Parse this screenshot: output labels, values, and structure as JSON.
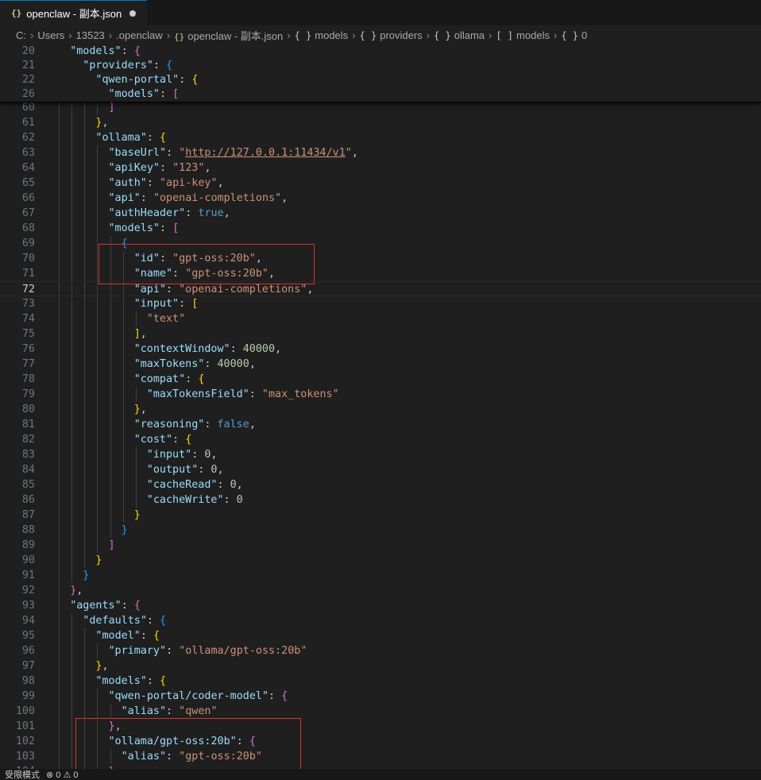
{
  "tab": {
    "icon": "json-file-icon",
    "title": "openclaw - 副本.json"
  },
  "breadcrumb": [
    {
      "label": "C:",
      "icon": "none"
    },
    {
      "label": "Users",
      "icon": "none"
    },
    {
      "label": "13523",
      "icon": "none"
    },
    {
      "label": ".openclaw",
      "icon": "none"
    },
    {
      "label": "openclaw - 副本.json",
      "icon": "json-file-icon"
    },
    {
      "label": "models",
      "icon": "object-icon"
    },
    {
      "label": "providers",
      "icon": "object-icon"
    },
    {
      "label": "ollama",
      "icon": "object-icon"
    },
    {
      "label": "models",
      "icon": "array-icon"
    },
    {
      "label": "0",
      "icon": "object-icon"
    }
  ],
  "sticky_lines": [
    {
      "num": "20",
      "indent": 2,
      "tokens": [
        [
          "k",
          "\"models\""
        ],
        [
          "p",
          ": "
        ],
        [
          "b2",
          "{"
        ]
      ]
    },
    {
      "num": "21",
      "indent": 3,
      "tokens": [
        [
          "k",
          "\"providers\""
        ],
        [
          "p",
          ": "
        ],
        [
          "b3",
          "{"
        ]
      ]
    },
    {
      "num": "22",
      "indent": 4,
      "tokens": [
        [
          "k",
          "\"qwen-portal\""
        ],
        [
          "p",
          ": "
        ],
        [
          "b1",
          "{"
        ]
      ]
    },
    {
      "num": "26",
      "indent": 5,
      "tokens": [
        [
          "k",
          "\"models\""
        ],
        [
          "p",
          ": "
        ],
        [
          "b2",
          "["
        ]
      ]
    }
  ],
  "lines": [
    {
      "num": "60",
      "indent": 5,
      "tokens": [
        [
          "b2",
          "]"
        ]
      ]
    },
    {
      "num": "61",
      "indent": 4,
      "tokens": [
        [
          "b1",
          "}"
        ],
        [
          "p",
          ","
        ]
      ]
    },
    {
      "num": "62",
      "indent": 4,
      "tokens": [
        [
          "k",
          "\"ollama\""
        ],
        [
          "p",
          ": "
        ],
        [
          "b1",
          "{"
        ]
      ]
    },
    {
      "num": "63",
      "indent": 5,
      "tokens": [
        [
          "k",
          "\"baseUrl\""
        ],
        [
          "p",
          ": "
        ],
        [
          "s",
          "\""
        ],
        [
          "u",
          "http://127.0.0.1:11434/v1"
        ],
        [
          "s",
          "\""
        ],
        [
          "p",
          ","
        ]
      ]
    },
    {
      "num": "64",
      "indent": 5,
      "tokens": [
        [
          "k",
          "\"apiKey\""
        ],
        [
          "p",
          ": "
        ],
        [
          "s",
          "\"123\""
        ],
        [
          "p",
          ","
        ]
      ]
    },
    {
      "num": "65",
      "indent": 5,
      "tokens": [
        [
          "k",
          "\"auth\""
        ],
        [
          "p",
          ": "
        ],
        [
          "s",
          "\"api-key\""
        ],
        [
          "p",
          ","
        ]
      ]
    },
    {
      "num": "66",
      "indent": 5,
      "tokens": [
        [
          "k",
          "\"api\""
        ],
        [
          "p",
          ": "
        ],
        [
          "s",
          "\"openai-completions\""
        ],
        [
          "p",
          ","
        ]
      ]
    },
    {
      "num": "67",
      "indent": 5,
      "tokens": [
        [
          "k",
          "\"authHeader\""
        ],
        [
          "p",
          ": "
        ],
        [
          "b",
          "true"
        ],
        [
          "p",
          ","
        ]
      ]
    },
    {
      "num": "68",
      "indent": 5,
      "tokens": [
        [
          "k",
          "\"models\""
        ],
        [
          "p",
          ": "
        ],
        [
          "b2",
          "["
        ]
      ]
    },
    {
      "num": "69",
      "indent": 6,
      "tokens": [
        [
          "b3",
          "{"
        ]
      ]
    },
    {
      "num": "70",
      "indent": 7,
      "tokens": [
        [
          "k",
          "\"id\""
        ],
        [
          "p",
          ": "
        ],
        [
          "s",
          "\"gpt-oss:20b\""
        ],
        [
          "p",
          ","
        ]
      ]
    },
    {
      "num": "71",
      "indent": 7,
      "tokens": [
        [
          "k",
          "\"name\""
        ],
        [
          "p",
          ": "
        ],
        [
          "s",
          "\"gpt-oss:20b\""
        ],
        [
          "p",
          ","
        ]
      ]
    },
    {
      "num": "72",
      "indent": 7,
      "tokens": [
        [
          "k",
          "\"api\""
        ],
        [
          "p",
          ": "
        ],
        [
          "s",
          "\"openai-completions\""
        ],
        [
          "p",
          ","
        ]
      ],
      "current": true
    },
    {
      "num": "73",
      "indent": 7,
      "tokens": [
        [
          "k",
          "\"input\""
        ],
        [
          "p",
          ": "
        ],
        [
          "b1",
          "["
        ]
      ]
    },
    {
      "num": "74",
      "indent": 8,
      "tokens": [
        [
          "s",
          "\"text\""
        ]
      ]
    },
    {
      "num": "75",
      "indent": 7,
      "tokens": [
        [
          "b1",
          "]"
        ],
        [
          "p",
          ","
        ]
      ]
    },
    {
      "num": "76",
      "indent": 7,
      "tokens": [
        [
          "k",
          "\"contextWindow\""
        ],
        [
          "p",
          ": "
        ],
        [
          "n",
          "40000"
        ],
        [
          "p",
          ","
        ]
      ]
    },
    {
      "num": "77",
      "indent": 7,
      "tokens": [
        [
          "k",
          "\"maxTokens\""
        ],
        [
          "p",
          ": "
        ],
        [
          "n",
          "40000"
        ],
        [
          "p",
          ","
        ]
      ]
    },
    {
      "num": "78",
      "indent": 7,
      "tokens": [
        [
          "k",
          "\"compat\""
        ],
        [
          "p",
          ": "
        ],
        [
          "b1",
          "{"
        ]
      ]
    },
    {
      "num": "79",
      "indent": 8,
      "tokens": [
        [
          "k",
          "\"maxTokensField\""
        ],
        [
          "p",
          ": "
        ],
        [
          "s",
          "\"max_tokens\""
        ]
      ]
    },
    {
      "num": "80",
      "indent": 7,
      "tokens": [
        [
          "b1",
          "}"
        ],
        [
          "p",
          ","
        ]
      ]
    },
    {
      "num": "81",
      "indent": 7,
      "tokens": [
        [
          "k",
          "\"reasoning\""
        ],
        [
          "p",
          ": "
        ],
        [
          "b",
          "false"
        ],
        [
          "p",
          ","
        ]
      ]
    },
    {
      "num": "82",
      "indent": 7,
      "tokens": [
        [
          "k",
          "\"cost\""
        ],
        [
          "p",
          ": "
        ],
        [
          "b1",
          "{"
        ]
      ]
    },
    {
      "num": "83",
      "indent": 8,
      "tokens": [
        [
          "k",
          "\"input\""
        ],
        [
          "p",
          ": "
        ],
        [
          "n",
          "0"
        ],
        [
          "p",
          ","
        ]
      ]
    },
    {
      "num": "84",
      "indent": 8,
      "tokens": [
        [
          "k",
          "\"output\""
        ],
        [
          "p",
          ": "
        ],
        [
          "n",
          "0"
        ],
        [
          "p",
          ","
        ]
      ]
    },
    {
      "num": "85",
      "indent": 8,
      "tokens": [
        [
          "k",
          "\"cacheRead\""
        ],
        [
          "p",
          ": "
        ],
        [
          "n",
          "0"
        ],
        [
          "p",
          ","
        ]
      ]
    },
    {
      "num": "86",
      "indent": 8,
      "tokens": [
        [
          "k",
          "\"cacheWrite\""
        ],
        [
          "p",
          ": "
        ],
        [
          "n",
          "0"
        ]
      ]
    },
    {
      "num": "87",
      "indent": 7,
      "tokens": [
        [
          "b1",
          "}"
        ]
      ]
    },
    {
      "num": "88",
      "indent": 6,
      "tokens": [
        [
          "b3",
          "}"
        ]
      ]
    },
    {
      "num": "89",
      "indent": 5,
      "tokens": [
        [
          "b2",
          "]"
        ]
      ]
    },
    {
      "num": "90",
      "indent": 4,
      "tokens": [
        [
          "b1",
          "}"
        ]
      ]
    },
    {
      "num": "91",
      "indent": 3,
      "tokens": [
        [
          "b3",
          "}"
        ]
      ]
    },
    {
      "num": "92",
      "indent": 2,
      "tokens": [
        [
          "b2",
          "}"
        ],
        [
          "p",
          ","
        ]
      ]
    },
    {
      "num": "93",
      "indent": 2,
      "tokens": [
        [
          "k",
          "\"agents\""
        ],
        [
          "p",
          ": "
        ],
        [
          "b2",
          "{"
        ]
      ]
    },
    {
      "num": "94",
      "indent": 3,
      "tokens": [
        [
          "k",
          "\"defaults\""
        ],
        [
          "p",
          ": "
        ],
        [
          "b3",
          "{"
        ]
      ]
    },
    {
      "num": "95",
      "indent": 4,
      "tokens": [
        [
          "k",
          "\"model\""
        ],
        [
          "p",
          ": "
        ],
        [
          "b1",
          "{"
        ]
      ]
    },
    {
      "num": "96",
      "indent": 5,
      "tokens": [
        [
          "k",
          "\"primary\""
        ],
        [
          "p",
          ": "
        ],
        [
          "s",
          "\"ollama/gpt-oss:20b\""
        ]
      ]
    },
    {
      "num": "97",
      "indent": 4,
      "tokens": [
        [
          "b1",
          "}"
        ],
        [
          "p",
          ","
        ]
      ]
    },
    {
      "num": "98",
      "indent": 4,
      "tokens": [
        [
          "k",
          "\"models\""
        ],
        [
          "p",
          ": "
        ],
        [
          "b1",
          "{"
        ]
      ]
    },
    {
      "num": "99",
      "indent": 5,
      "tokens": [
        [
          "k",
          "\"qwen-portal/coder-model\""
        ],
        [
          "p",
          ": "
        ],
        [
          "b2",
          "{"
        ]
      ]
    },
    {
      "num": "100",
      "indent": 6,
      "tokens": [
        [
          "k",
          "\"alias\""
        ],
        [
          "p",
          ": "
        ],
        [
          "s",
          "\"qwen\""
        ]
      ]
    },
    {
      "num": "101",
      "indent": 5,
      "tokens": [
        [
          "b2",
          "}"
        ],
        [
          "p",
          ","
        ]
      ]
    },
    {
      "num": "102",
      "indent": 5,
      "tokens": [
        [
          "k",
          "\"ollama/gpt-oss:20b\""
        ],
        [
          "p",
          ": "
        ],
        [
          "b2",
          "{"
        ]
      ]
    },
    {
      "num": "103",
      "indent": 6,
      "tokens": [
        [
          "k",
          "\"alias\""
        ],
        [
          "p",
          ": "
        ],
        [
          "s",
          "\"gpt-oss:20b\""
        ]
      ]
    },
    {
      "num": "104",
      "indent": 5,
      "tokens": [
        [
          "b2",
          "}"
        ]
      ]
    }
  ],
  "statusbar": {
    "mode": "受限模式",
    "problems": "⊗ 0 ⚠ 0"
  },
  "colors": {
    "highlight_box": "#d8342c",
    "accent": "#0078d4"
  }
}
